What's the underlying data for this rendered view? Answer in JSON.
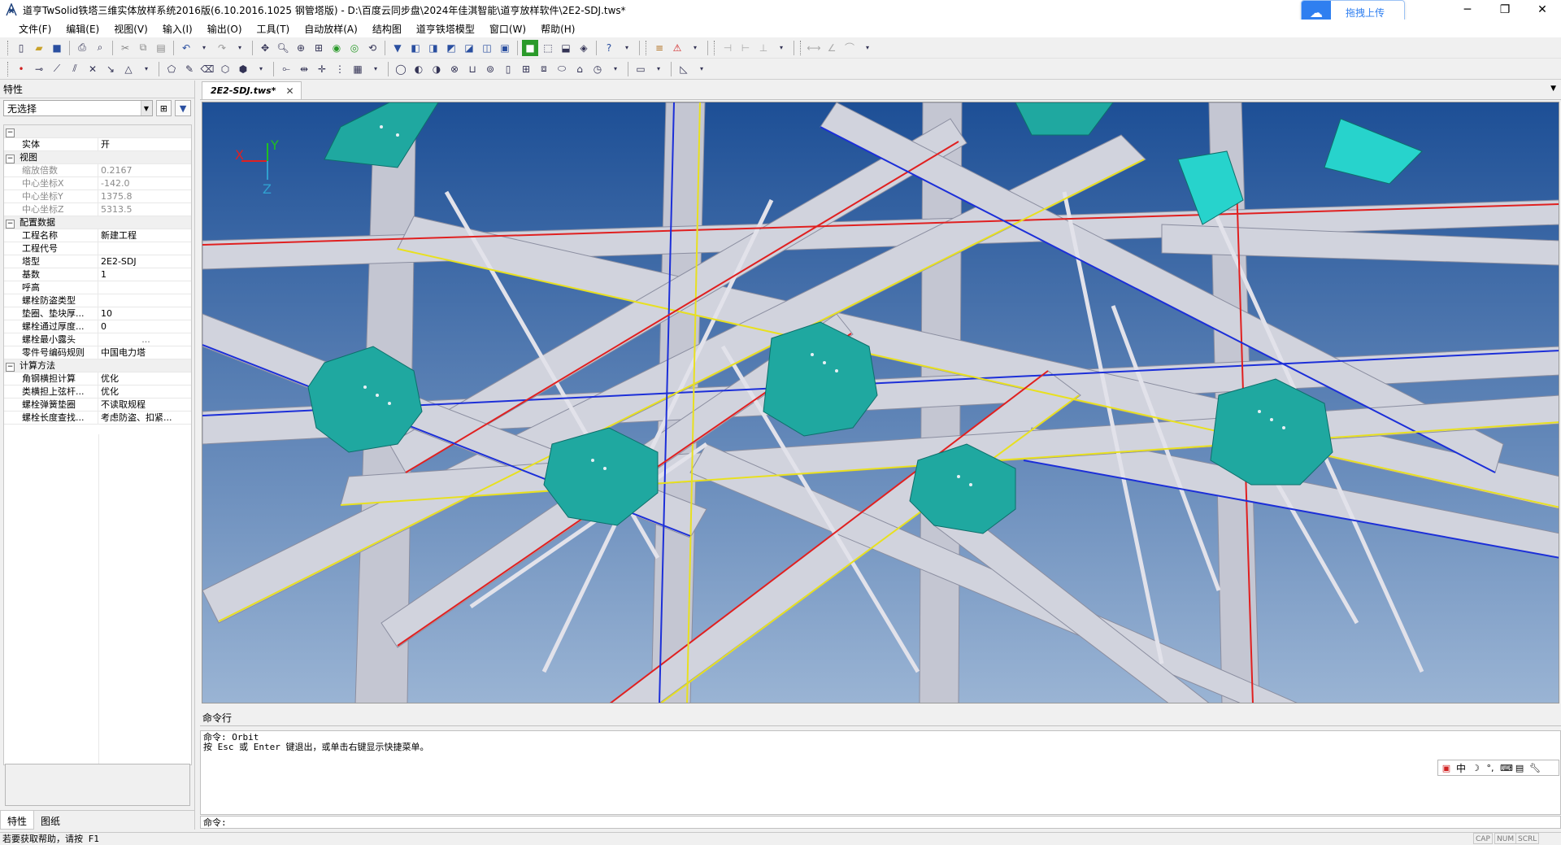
{
  "window": {
    "title": "道亨TwSolid铁塔三维实体放样系统2016版(6.10.2016.1025 钢管塔版) - D:\\百度云同步盘\\2024年佳淇智能\\道亨放样软件\\2E2-SDJ.tws*",
    "upload_label": "拖拽上传",
    "minimize_icon": "minimize-icon",
    "maximize_icon": "restore-icon",
    "close_icon": "close-icon"
  },
  "menu": [
    "文件(F)",
    "编辑(E)",
    "视图(V)",
    "输入(I)",
    "输出(O)",
    "工具(T)",
    "自动放样(A)",
    "结构图",
    "道亨铁塔模型",
    "窗口(W)",
    "帮助(H)"
  ],
  "properties_panel": {
    "title": "特性",
    "selection": "无选择",
    "categories": [
      {
        "label": "",
        "rows": [
          {
            "key": "实体",
            "value": "开",
            "dim": false
          }
        ]
      },
      {
        "label": "视图",
        "rows": [
          {
            "key": "缩放倍数",
            "value": "0.2167",
            "dim": true
          },
          {
            "key": "中心坐标X",
            "value": "-142.0",
            "dim": true
          },
          {
            "key": "中心坐标Y",
            "value": "1375.8",
            "dim": true
          },
          {
            "key": "中心坐标Z",
            "value": "5313.5",
            "dim": true
          }
        ]
      },
      {
        "label": "配置数据",
        "rows": [
          {
            "key": "工程名称",
            "value": "新建工程",
            "dim": false
          },
          {
            "key": "工程代号",
            "value": "",
            "dim": false
          },
          {
            "key": "塔型",
            "value": "2E2-SDJ",
            "dim": false
          },
          {
            "key": "基数",
            "value": "1",
            "dim": false
          },
          {
            "key": "呼高",
            "value": "",
            "dim": false
          },
          {
            "key": "螺栓防盗类型",
            "value": "",
            "dim": false
          },
          {
            "key": "垫圈、垫块厚...",
            "value": "10",
            "dim": false
          },
          {
            "key": "螺栓通过厚度...",
            "value": "0",
            "dim": false
          },
          {
            "key": "螺栓最小露头",
            "value": "...",
            "dim": false
          },
          {
            "key": "零件号编码规则",
            "value": "中国电力塔",
            "dim": false
          }
        ]
      },
      {
        "label": "计算方法",
        "rows": [
          {
            "key": "角钢横担计算",
            "value": "优化",
            "dim": false
          },
          {
            "key": "类横担上弦杆...",
            "value": "优化",
            "dim": false
          },
          {
            "key": "螺栓弹簧垫圈",
            "value": "不读取规程",
            "dim": false
          },
          {
            "key": "螺栓长度查找...",
            "value": "考虑防盗、扣紧...",
            "dim": false
          }
        ]
      }
    ],
    "bottom_tabs": [
      "特性",
      "图纸"
    ]
  },
  "document": {
    "tab_label": "2E2-SDJ.tws*",
    "axis_labels": {
      "x": "X",
      "y": "Y",
      "z": "Z"
    },
    "colors": {
      "sky_top": "#1d4f96",
      "sky_bottom": "#9ab4d4",
      "member": "#c4c6d2",
      "plate": "#1fa8a0",
      "plate_light": "#27d3cc"
    }
  },
  "command": {
    "title": "命令行",
    "lines": [
      "命令: Orbit",
      "按 Esc 或 Enter 键退出，或单击右键显示快捷菜单。"
    ],
    "prompt": "命令:"
  },
  "ime": {
    "mode": "中"
  },
  "status": {
    "text": "若要获取帮助，请按 F1",
    "indicators": [
      "CAP",
      "NUM",
      "SCRL"
    ]
  }
}
